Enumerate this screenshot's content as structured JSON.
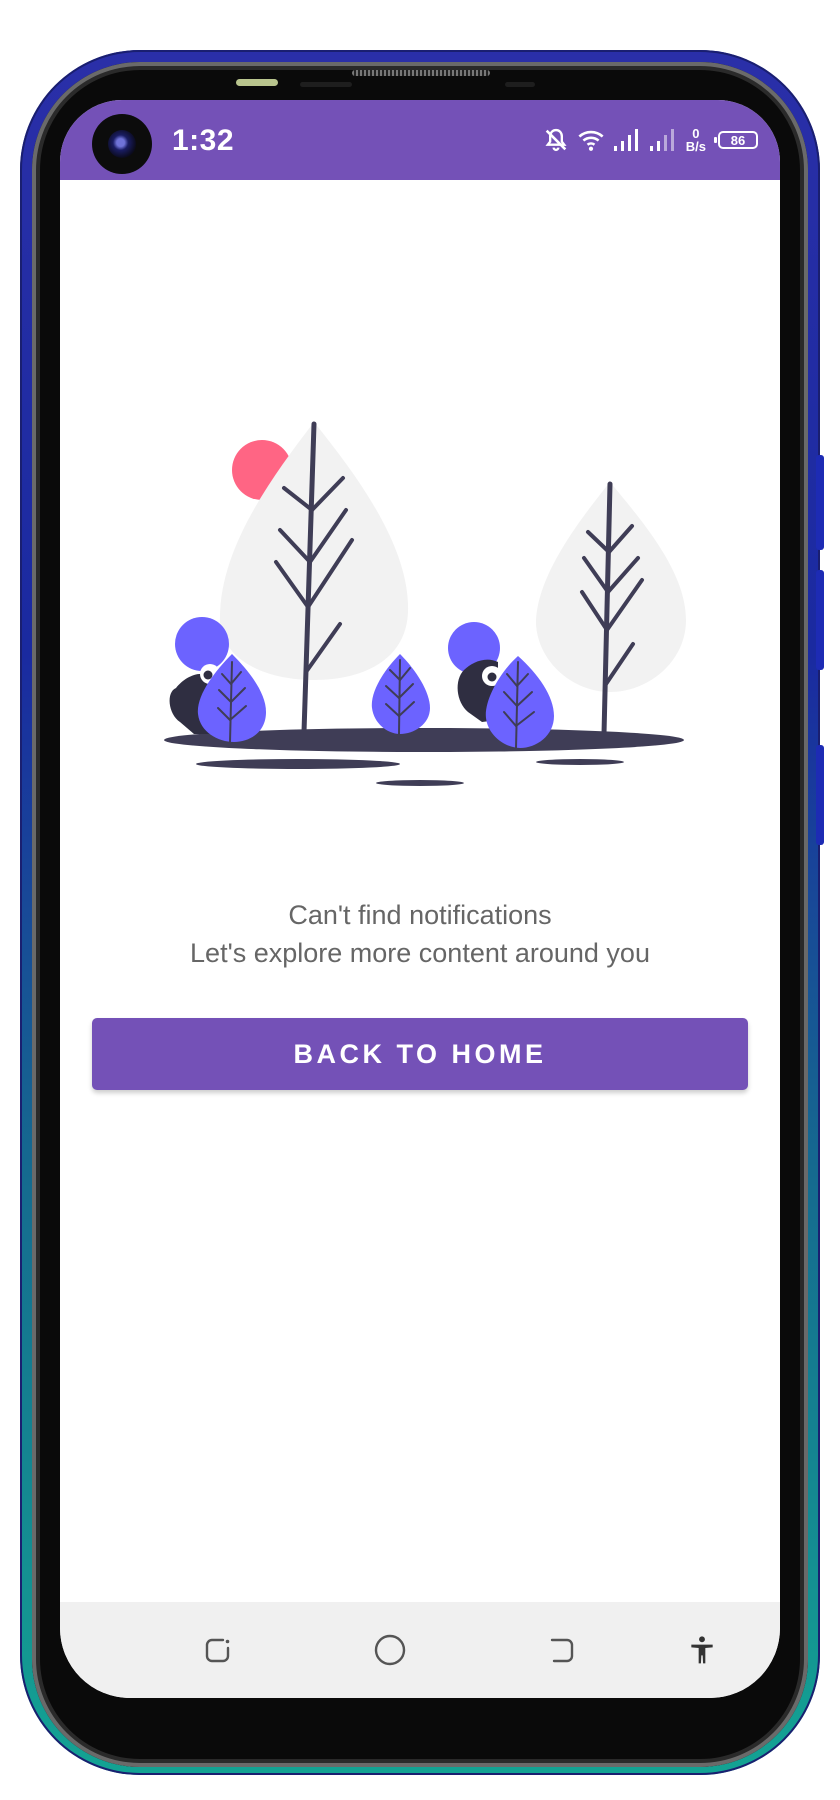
{
  "status_bar": {
    "time": "1:32",
    "net_speed_value": "0",
    "net_speed_unit": "B/s",
    "battery_level": "86",
    "background_color": "#7451b7",
    "icons": [
      "camera-cutout",
      "notifications-off-icon",
      "wifi-icon",
      "signal-icon",
      "signal-icon",
      "battery-icon"
    ]
  },
  "empty_state": {
    "title": "Can't find notifications",
    "subtitle": "Let's explore more content around you",
    "illustration": "trees-and-characters-illustration"
  },
  "actions": {
    "back_home_label": "BACK TO HOME"
  },
  "navigation_bar": {
    "buttons": [
      "recent-apps-icon",
      "home-icon",
      "back-icon",
      "accessibility-icon"
    ]
  },
  "colors": {
    "accent": "#7451b7",
    "illustration_primary": "#6c63ff",
    "illustration_dark": "#3f3d56",
    "sun": "#ff6584",
    "tree_foliage": "#f2f2f2",
    "text_secondary": "#666666",
    "nav_bar": "#f0f0f0"
  }
}
